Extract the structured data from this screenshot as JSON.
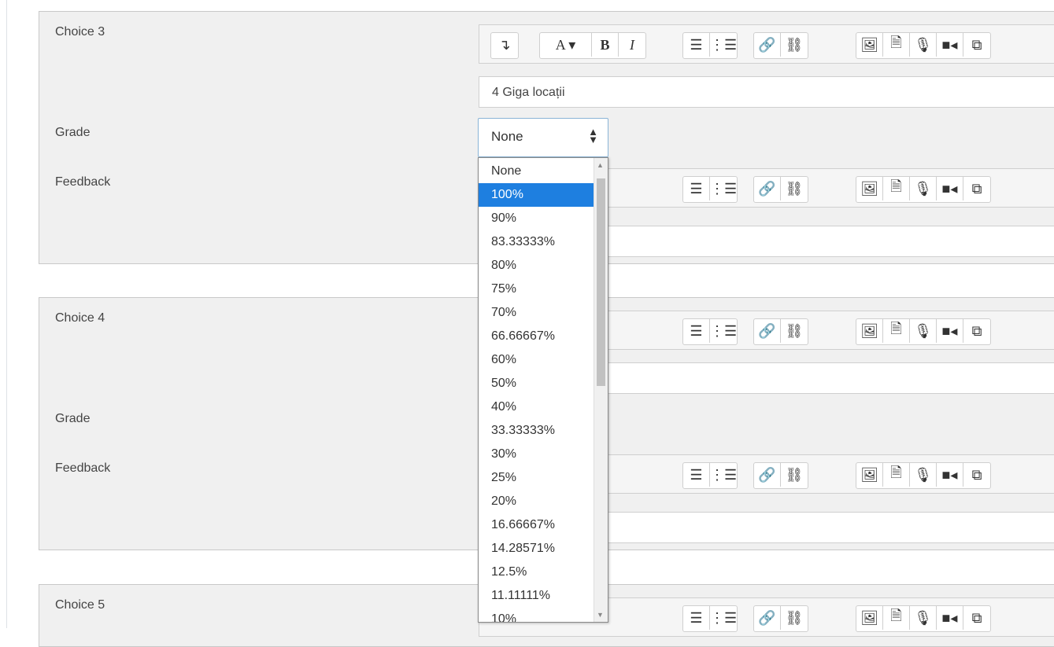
{
  "toolbar": {
    "buttons": [
      "↴",
      "A ▾",
      "B",
      "I",
      "☰",
      "⋮☰",
      "🔗",
      "⛓",
      "🖼",
      "🗎",
      "🎙",
      "■◂",
      "⧉"
    ]
  },
  "choice3": {
    "label": "Choice 3",
    "answer": "4 Giga locații",
    "grade_label": "Grade",
    "feedback_label": "Feedback"
  },
  "choice4": {
    "label": "Choice 4",
    "grade_label": "Grade",
    "feedback_label": "Feedback"
  },
  "choice5": {
    "label": "Choice 5"
  },
  "grade_select": {
    "value": "None",
    "options": [
      "None",
      "100%",
      "90%",
      "83.33333%",
      "80%",
      "75%",
      "70%",
      "66.66667%",
      "60%",
      "50%",
      "40%",
      "33.33333%",
      "30%",
      "25%",
      "20%",
      "16.66667%",
      "14.28571%",
      "12.5%",
      "11.11111%",
      "10%"
    ],
    "highlighted": "100%"
  }
}
